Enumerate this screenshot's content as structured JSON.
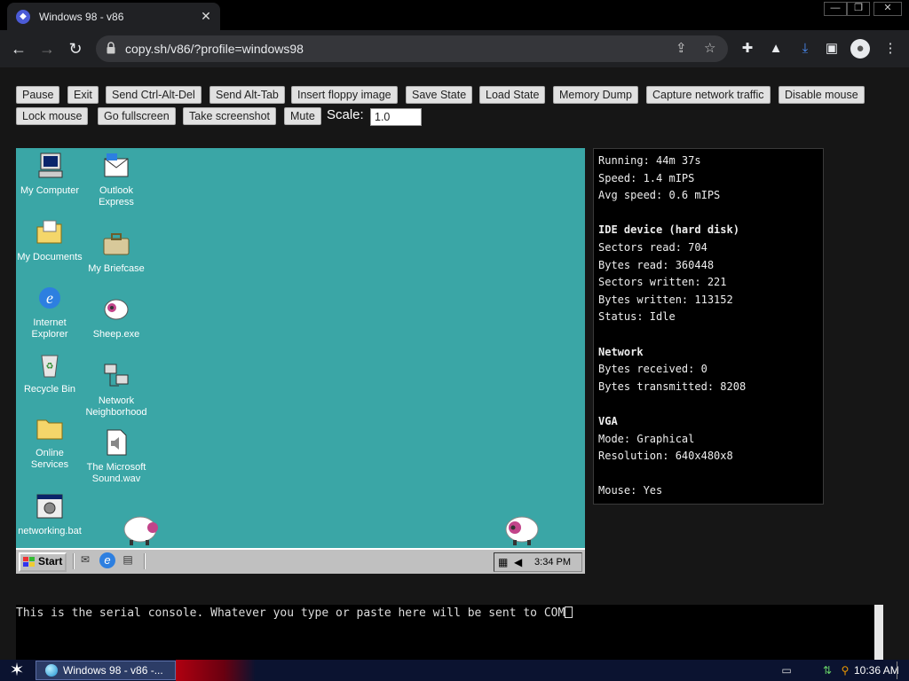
{
  "browser": {
    "tab_title": "Windows 98 - v86",
    "tab_close": "✕",
    "url": "copy.sh/v86/?profile=windows98",
    "window_controls": [
      "—",
      "❐",
      "✕"
    ]
  },
  "controls": {
    "buttons": [
      "Pause",
      "Exit",
      "Send Ctrl-Alt-Del",
      "Send Alt-Tab",
      "Insert floppy image",
      "Save State",
      "Load State",
      "Memory Dump",
      "Capture network traffic",
      "Disable mouse",
      "Lock mouse",
      "Go fullscreen",
      "Take screenshot",
      "Mute"
    ],
    "scale_label": "Scale:",
    "scale_value": "1.0"
  },
  "win98": {
    "desktop_icons": [
      {
        "label": "My Computer",
        "icon": "computer-icon"
      },
      {
        "label": "Outlook Express",
        "icon": "outlook-express-icon"
      },
      {
        "label": "My Documents",
        "icon": "folder-documents-icon"
      },
      {
        "label": "My Briefcase",
        "icon": "briefcase-icon"
      },
      {
        "label": "Internet Explorer",
        "icon": "internet-explorer-icon"
      },
      {
        "label": "Sheep.exe",
        "icon": "sheep-icon"
      },
      {
        "label": "Recycle Bin",
        "icon": "recycle-bin-icon"
      },
      {
        "label": "Network Neighborhood",
        "icon": "network-icon"
      },
      {
        "label": "Online Services",
        "icon": "folder-icon"
      },
      {
        "label": "The Microsoft Sound.wav",
        "icon": "sound-file-icon"
      },
      {
        "label": "networking.bat",
        "icon": "batch-file-icon"
      }
    ],
    "start_label": "Start",
    "clock": "3:34 PM"
  },
  "stats": {
    "running": "Running: 44m 37s",
    "speed": "Speed: 1.4 mIPS",
    "avg_speed": "Avg speed: 0.6 mIPS",
    "ide_header": "IDE device (hard disk)",
    "sectors_read": "Sectors read: 704",
    "bytes_read": "Bytes read: 360448",
    "sectors_written": "Sectors written: 221",
    "bytes_written": "Bytes written: 113152",
    "ide_status": "Status: Idle",
    "network_header": "Network",
    "bytes_received": "Bytes received: 0",
    "bytes_transmitted": "Bytes transmitted: 8208",
    "vga_header": "VGA",
    "vga_mode": "Mode: Graphical",
    "vga_resolution": "Resolution: 640x480x8",
    "mouse": "Mouse: Yes"
  },
  "serial": {
    "text": "This is the serial console. Whatever you type or paste here will be sent to COM"
  },
  "host_taskbar": {
    "task_label": "Windows 98 - v86 -...",
    "clock": "10:36 AM"
  }
}
